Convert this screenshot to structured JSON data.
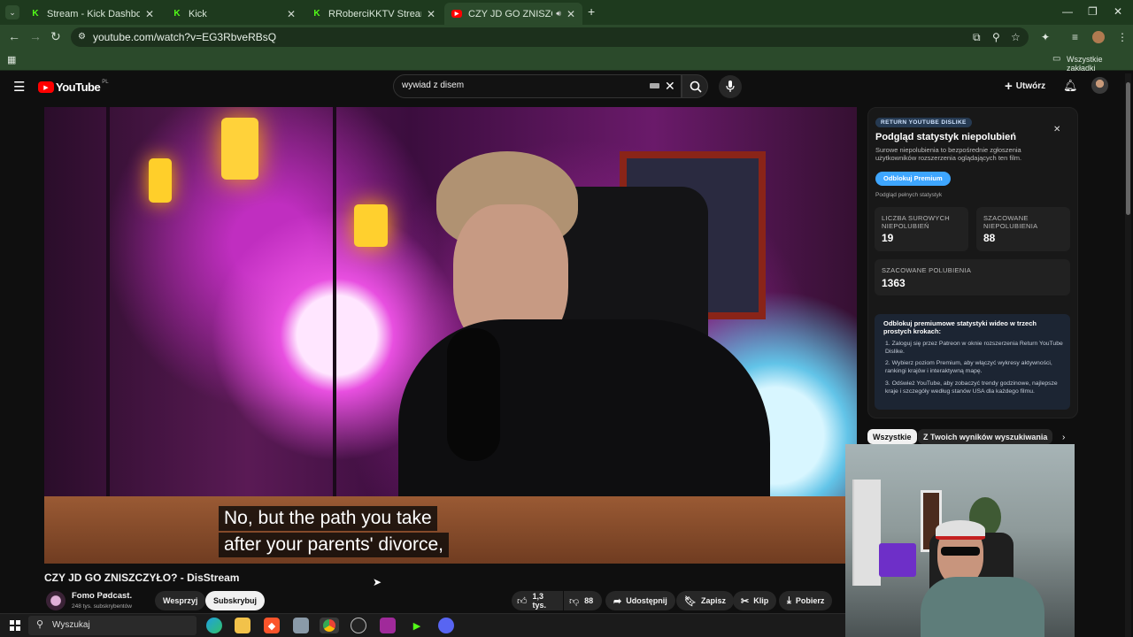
{
  "browser": {
    "tabs": [
      {
        "title": "Stream - Kick Dashboard",
        "favicon": "kick-icon",
        "active": false
      },
      {
        "title": "Kick",
        "favicon": "kick-icon",
        "active": false
      },
      {
        "title": "RRoberciKKTV Stream - Watch",
        "favicon": "kick-icon",
        "active": false
      },
      {
        "title": "CZY JD GO ZNISZCZYŁO? -",
        "favicon": "youtube-icon",
        "active": true
      }
    ],
    "url": "youtube.com/watch?v=EG3RbveRBsQ",
    "bookmarks_folder": "Wszystkie zakładki",
    "accent": "#2b4a2b"
  },
  "youtube": {
    "logo_text": "YouTube",
    "logo_region": "PL",
    "search_value": "wywiad z disem",
    "create_label": "Utwórz"
  },
  "video": {
    "subtitle_lines": [
      "No, but the path you take",
      "after your parents' divorce,"
    ],
    "title": "CZY JD GO ZNISZCZYŁO? - DisStream",
    "channel_name": "Fomo Pødcast.",
    "subscribers": "248 tys. subskrybentów",
    "support_label": "Wesprzyj",
    "subscribe_label": "Subskrybuj",
    "likes": "1,3 tys.",
    "dislikes": "88",
    "share_label": "Udostępnij",
    "save_label": "Zapisz",
    "clip_label": "Klip",
    "download_label": "Pobierz"
  },
  "rtd_panel": {
    "badge": "RETURN YOUTUBE DISLIKE",
    "heading": "Podgląd statystyk niepolubień",
    "description": "Surowe niepolubienia to bezpośrednie zgłoszenia użytkowników rozszerzenia oglądających ten film.",
    "unlock_button": "Odblokuj Premium",
    "full_stats_note": "Podgląd pełnych statystyk",
    "raw_dislikes_label": "LICZBA SUROWYCH NIEPOLUBIEŃ",
    "raw_dislikes_value": "19",
    "est_dislikes_label": "SZACOWANE NIEPOLUBIENIA",
    "est_dislikes_value": "88",
    "est_likes_label": "SZACOWANE POLUBIENIA",
    "est_likes_value": "1363",
    "promo_title": "Odblokuj premiumowe statystyki wideo w trzech prostych krokach:",
    "steps": [
      "Zaloguj się przez Patreon w oknie rozszerzenia Return YouTube Dislike.",
      "Wybierz poziom Premium, aby włączyć wykresy aktywności, rankingi krajów i interaktywną mapę.",
      "Odśwież YouTube, aby zobaczyć trendy godzinowe, najlepsze kraje i szczegóły według stanów USA dla każdego filmu."
    ],
    "button_color": "#3ea6ff"
  },
  "chips": [
    "Wszystkie",
    "Z Twoich wyników wyszukiwania"
  ],
  "taskbar": {
    "search_placeholder": "Wyszukaj"
  }
}
